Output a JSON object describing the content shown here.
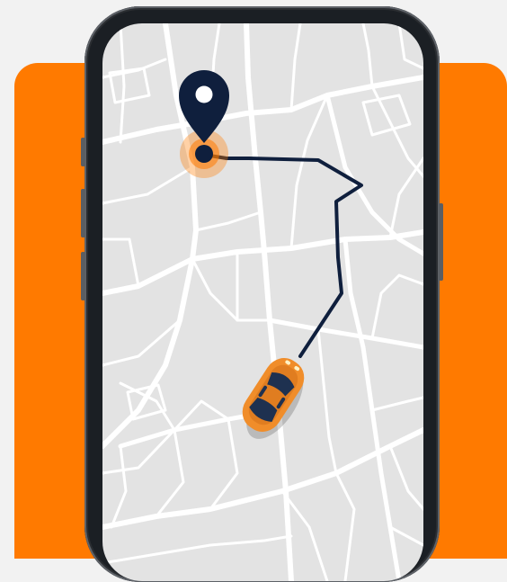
{
  "colors": {
    "background": "#f2f2f2",
    "accent": "#ff7a00",
    "map_background": "#e3e3e3",
    "map_roads": "#ffffff",
    "route_line": "#0f1f3d",
    "pin": "#0f1f3d",
    "car_body": "#f08d2a",
    "car_glass": "#1e3150",
    "phone_frame": "#1b1f24"
  },
  "icons": {
    "destination": "map-pin-icon",
    "vehicle": "car-icon"
  }
}
